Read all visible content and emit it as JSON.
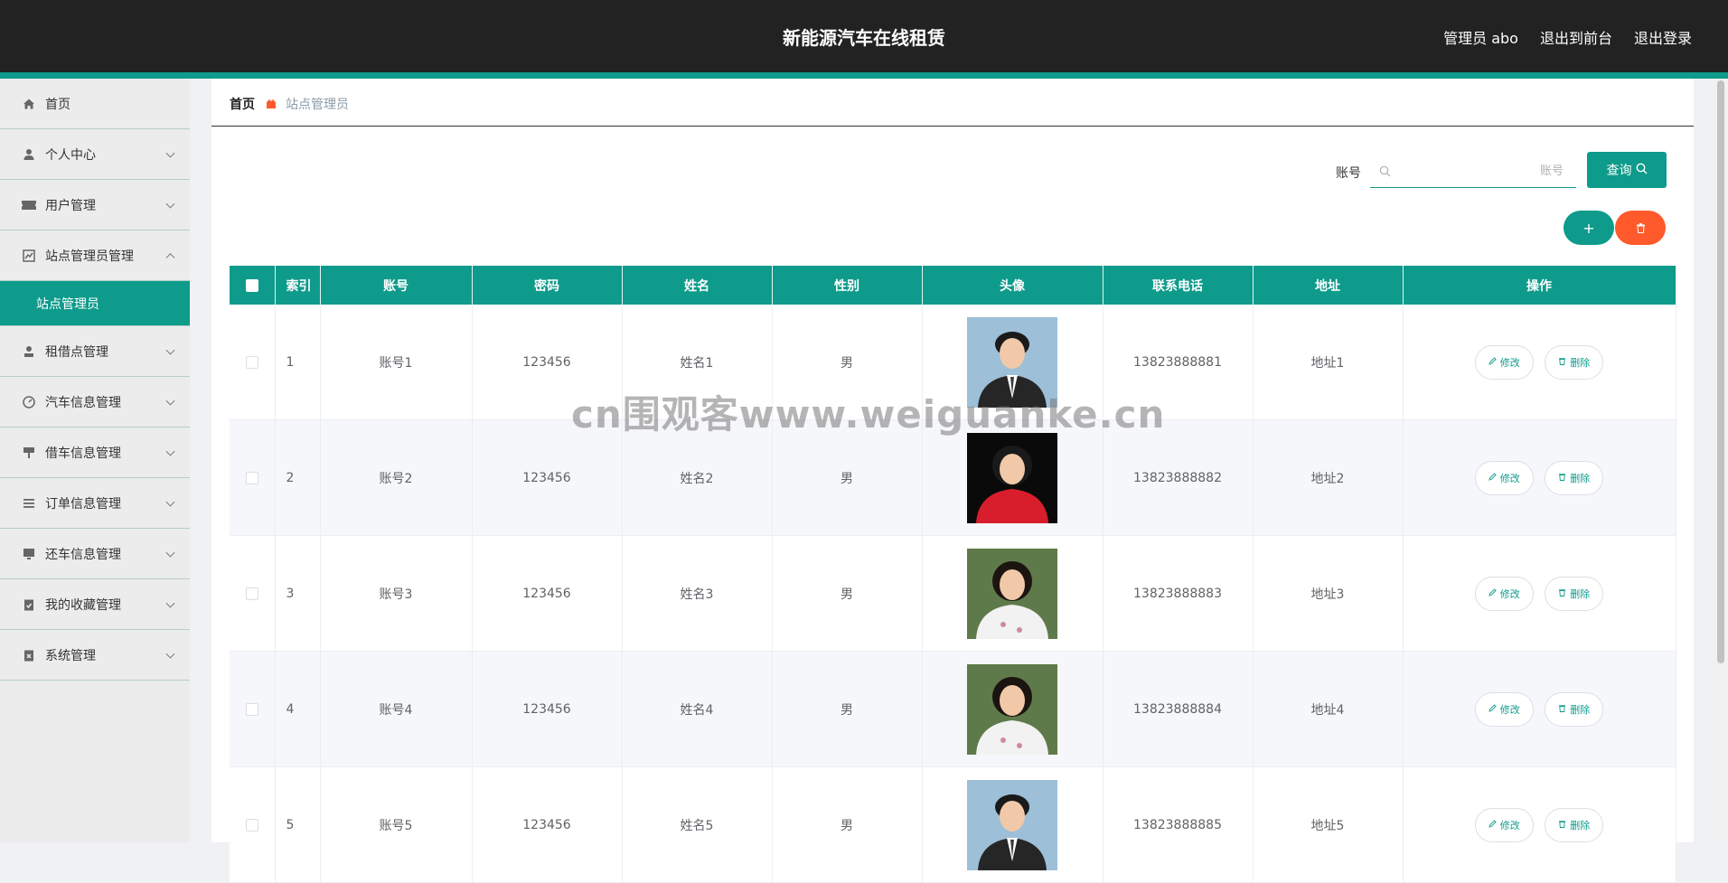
{
  "header": {
    "title": "新能源汽车在线租赁",
    "admin": "管理员 abo",
    "to_front": "退出到前台",
    "logout": "退出登录"
  },
  "sidebar": {
    "items": [
      {
        "label": "首页",
        "icon": "home-icon"
      },
      {
        "label": "个人中心",
        "icon": "user-icon"
      },
      {
        "label": "用户管理",
        "icon": "ticket-icon"
      },
      {
        "label": "站点管理员管理",
        "icon": "chart-icon"
      },
      {
        "label": "租借点管理",
        "icon": "person-icon"
      },
      {
        "label": "汽车信息管理",
        "icon": "gauge-icon"
      },
      {
        "label": "借车信息管理",
        "icon": "sign-icon"
      },
      {
        "label": "订单信息管理",
        "icon": "list-icon"
      },
      {
        "label": "还车信息管理",
        "icon": "monitor-icon"
      },
      {
        "label": "我的收藏管理",
        "icon": "clipboard-check-icon"
      },
      {
        "label": "系统管理",
        "icon": "clipboard-x-icon"
      }
    ],
    "active_sub": "站点管理员"
  },
  "breadcrumb": {
    "home": "首页",
    "current": "站点管理员"
  },
  "search": {
    "label": "账号",
    "placeholder": "账号",
    "button": "查询"
  },
  "actions": {
    "add": "+"
  },
  "table": {
    "headers": [
      "索引",
      "账号",
      "密码",
      "姓名",
      "性别",
      "头像",
      "联系电话",
      "地址",
      "操作"
    ],
    "rows": [
      {
        "index": "1",
        "account": "账号1",
        "password": "123456",
        "name": "姓名1",
        "gender": "男",
        "phone": "13823888881",
        "address": "地址1",
        "avatar": "man-suit"
      },
      {
        "index": "2",
        "account": "账号2",
        "password": "123456",
        "name": "姓名2",
        "gender": "男",
        "phone": "13823888882",
        "address": "地址2",
        "avatar": "woman-red"
      },
      {
        "index": "3",
        "account": "账号3",
        "password": "123456",
        "name": "姓名3",
        "gender": "男",
        "phone": "13823888883",
        "address": "地址3",
        "avatar": "woman-white"
      },
      {
        "index": "4",
        "account": "账号4",
        "password": "123456",
        "name": "姓名4",
        "gender": "男",
        "phone": "13823888884",
        "address": "地址4",
        "avatar": "woman-white"
      },
      {
        "index": "5",
        "account": "账号5",
        "password": "123456",
        "name": "姓名5",
        "gender": "男",
        "phone": "13823888885",
        "address": "地址5",
        "avatar": "man-suit"
      }
    ],
    "edit_label": "修改",
    "delete_label": "删除"
  },
  "watermark": "cn围观客www.weiguanke.cn",
  "colors": {
    "primary": "#0e9b8b",
    "danger": "#ff5a2c",
    "header_bg": "#222222"
  }
}
